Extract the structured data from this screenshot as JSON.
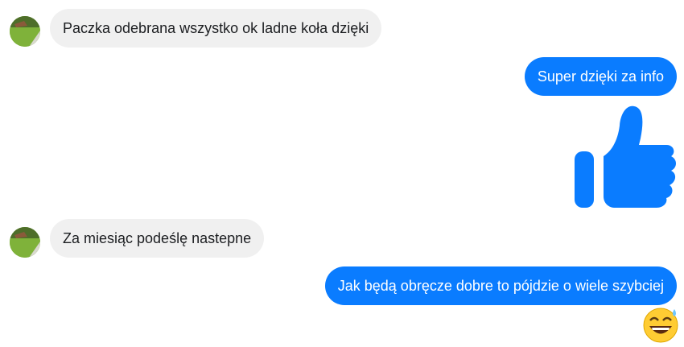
{
  "messages": [
    {
      "side": "incoming",
      "text": "Paczka odebrana wszystko ok ladne koła dzięki"
    },
    {
      "side": "outgoing",
      "text": "Super dzięki za info"
    },
    {
      "side": "outgoing",
      "sticker": "thumbs-up-icon"
    },
    {
      "side": "incoming",
      "text": "Za miesiąc podeślę nastepne"
    },
    {
      "side": "outgoing",
      "text": "Jak będą obręcze dobre to pójdzie o wiele szybciej"
    },
    {
      "side": "outgoing",
      "emoji": "grinning-sweat-emoji"
    }
  ],
  "colors": {
    "outgoing_bubble": "#0a7cff",
    "incoming_bubble": "#f0f0f0",
    "thumb": "#0a7cff"
  }
}
